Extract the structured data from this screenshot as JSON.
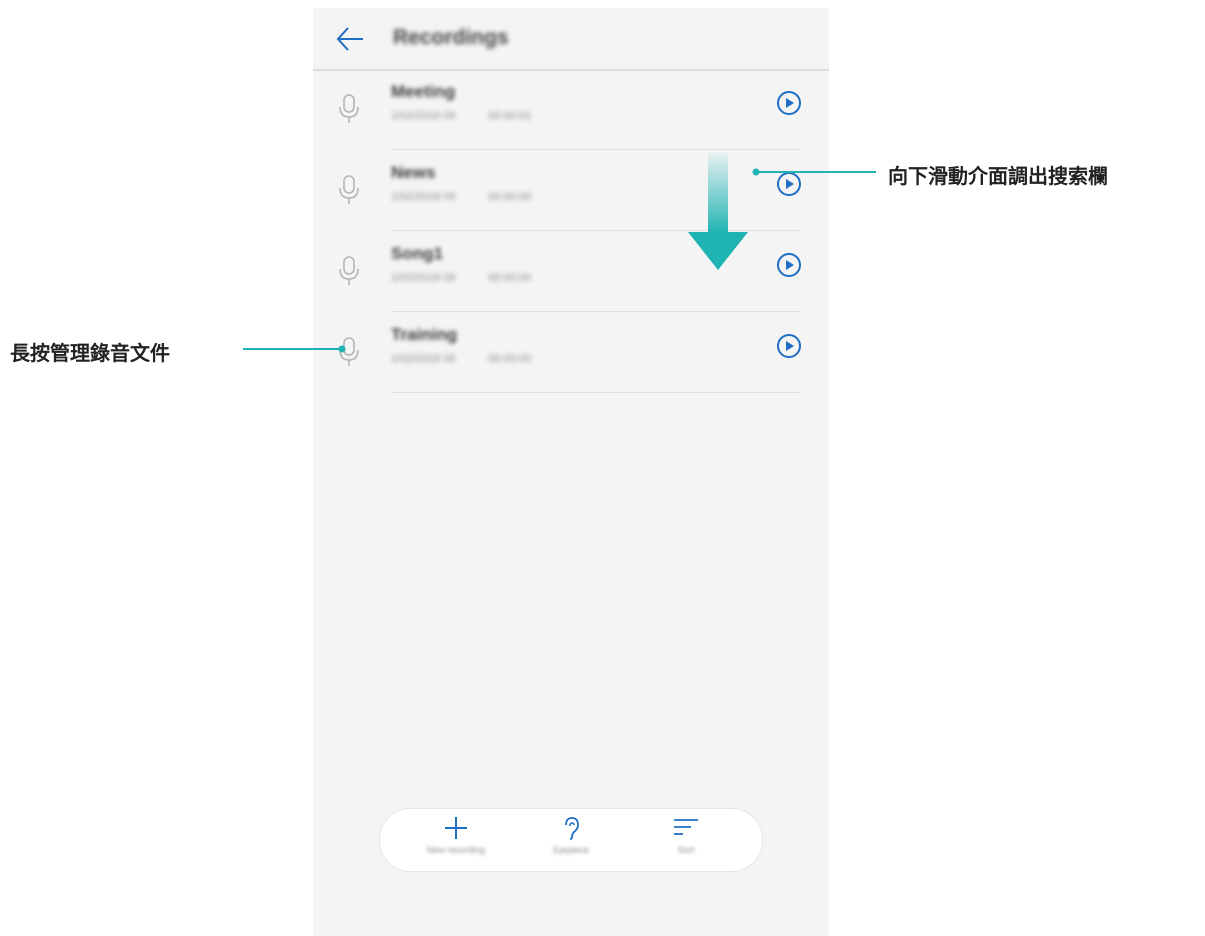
{
  "header": {
    "back_icon": "arrow-left-icon",
    "title": "Recordings"
  },
  "recordings": [
    {
      "name": "Meeting",
      "date": "1/02/2018 09",
      "duration": "00:00:01"
    },
    {
      "name": "News",
      "date": "1/02/2018 09",
      "duration": "00:00:00"
    },
    {
      "name": "Song1",
      "date": "1/02/2018 09",
      "duration": "00:00:00"
    },
    {
      "name": "Training",
      "date": "1/02/2018 09",
      "duration": "00:00:00"
    }
  ],
  "bottom_bar": {
    "new_recording": "New recording",
    "earpiece": "Earpiece",
    "sort": "Sort"
  },
  "annotations": {
    "swipe_down": "向下滑動介面調出搜索欄",
    "long_press": "長按管理錄音文件"
  },
  "colors": {
    "accent_blue": "#1f6ec4",
    "teal": "#1fb3b3",
    "mic_gray": "#b5b5b5"
  }
}
